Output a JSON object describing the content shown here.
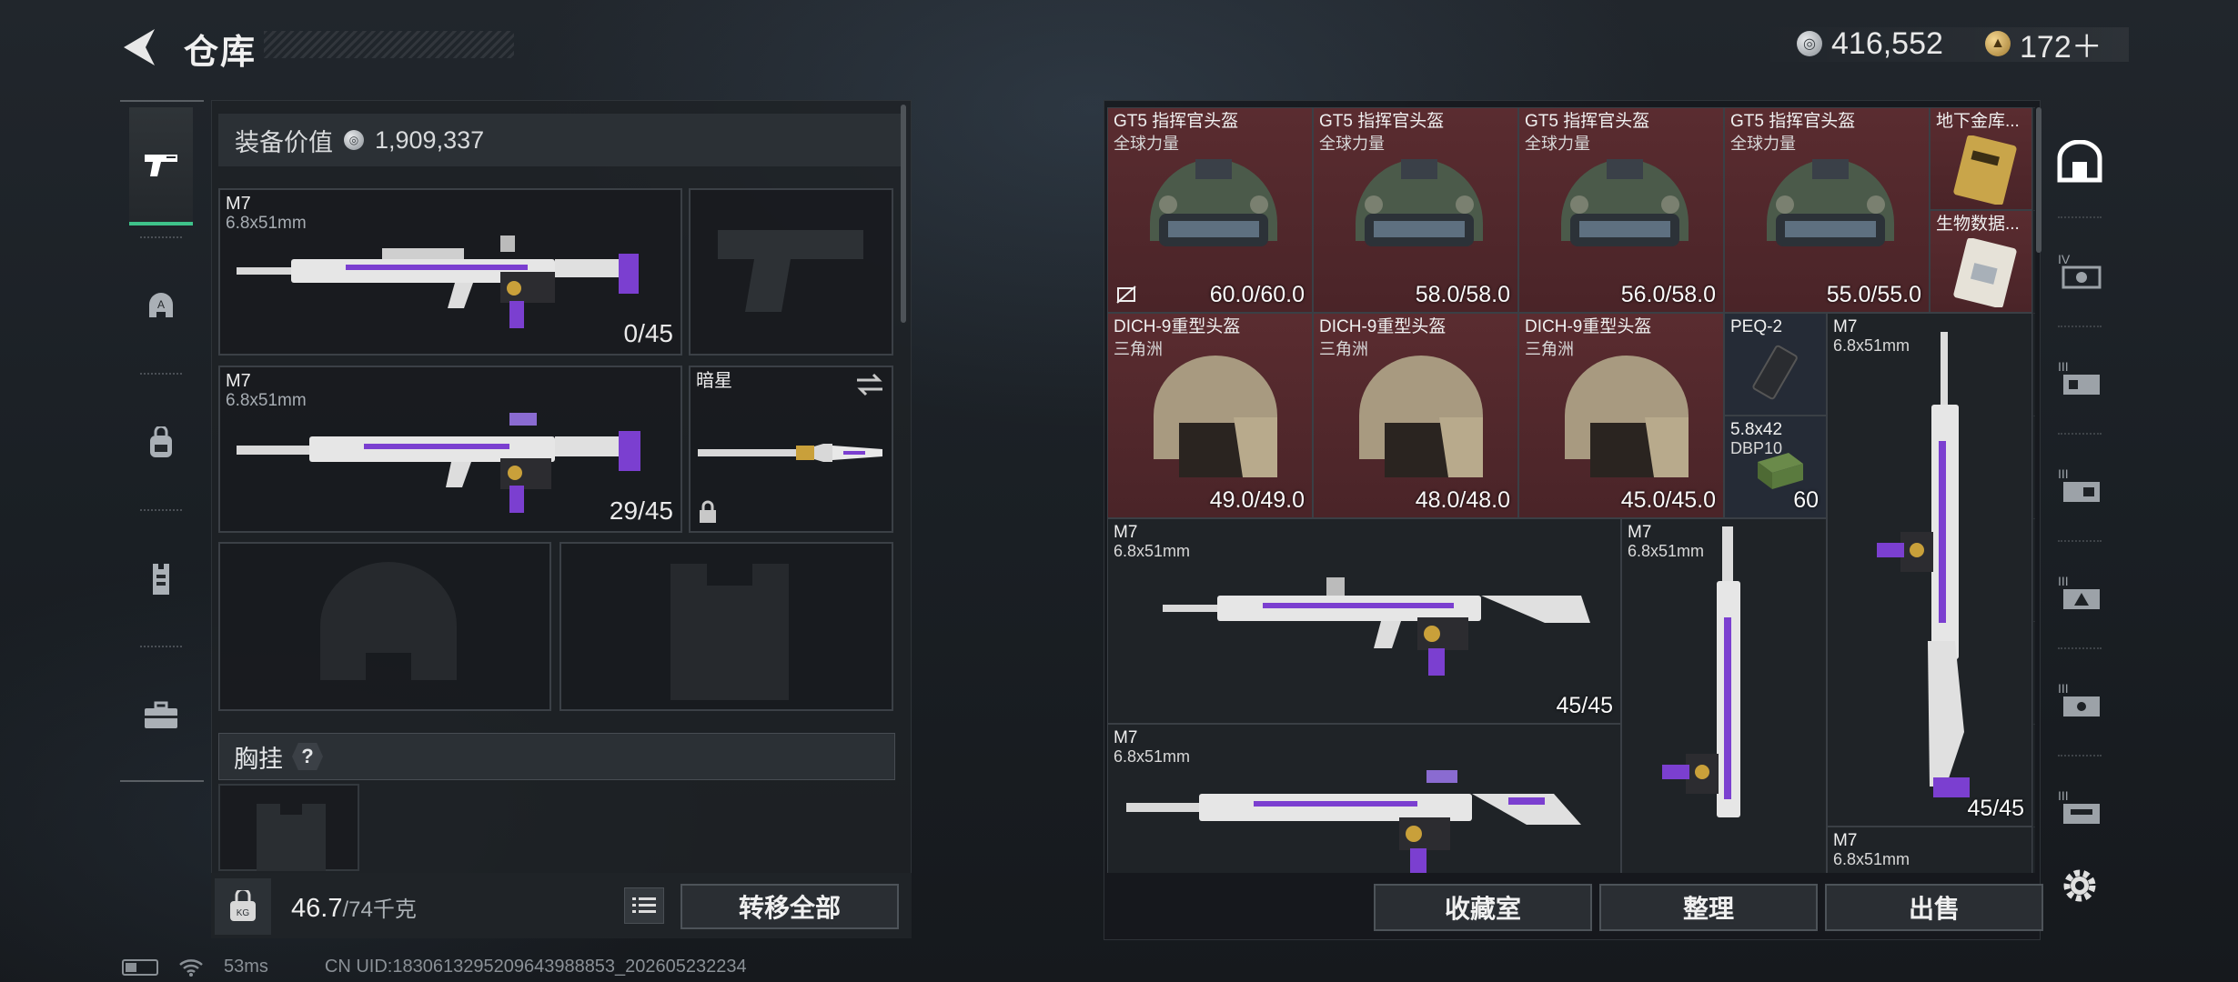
{
  "header": {
    "title": "仓库",
    "currency_silver": "416,552",
    "currency_gold": "172＋"
  },
  "left_panel": {
    "equipment_value_label": "装备价值",
    "equipment_value": "1,909,337",
    "primary_1": {
      "name": "M7",
      "caliber": "6.8x51mm",
      "ammo": "0/45"
    },
    "primary_2": {
      "name": "M7",
      "caliber": "6.8x51mm",
      "ammo": "29/45"
    },
    "melee": {
      "name": "暗星"
    },
    "chest_label": "胸挂",
    "chest_help": "?",
    "weight_current": "46.7",
    "weight_max": "/74千克",
    "transfer_all": "转移全部"
  },
  "stash": {
    "helmets_gt5": [
      {
        "name": "GT5 指挥官头盔",
        "sub": "全球力量",
        "durability": "60.0/60.0"
      },
      {
        "name": "GT5 指挥官头盔",
        "sub": "全球力量",
        "durability": "58.0/58.0"
      },
      {
        "name": "GT5 指挥官头盔",
        "sub": "全球力量",
        "durability": "56.0/58.0"
      },
      {
        "name": "GT5 指挥官头盔",
        "sub": "全球力量",
        "durability": "55.0/55.0"
      }
    ],
    "helmets_dich": [
      {
        "name": "DICH-9重型头盔",
        "sub": "三角洲",
        "durability": "49.0/49.0"
      },
      {
        "name": "DICH-9重型头盔",
        "sub": "三角洲",
        "durability": "48.0/48.0"
      },
      {
        "name": "DICH-9重型头盔",
        "sub": "三角洲",
        "durability": "45.0/45.0"
      }
    ],
    "card_1": "地下金库...",
    "card_2": "生物数据...",
    "peq": "PEQ-2",
    "ammo_item": {
      "name": "5.8x42",
      "sub": "DBP10",
      "count": "60"
    },
    "rifle_vertical_1": {
      "name": "M7",
      "caliber": "6.8x51mm",
      "ammo": "45/45"
    },
    "rifle_h1": {
      "name": "M7",
      "caliber": "6.8x51mm",
      "ammo": "45/45"
    },
    "rifle_h2": {
      "name": "M7",
      "caliber": "6.8x51mm"
    },
    "rifle_vertical_2": {
      "name": "M7",
      "caliber": "6.8x51mm"
    },
    "rifle_vertical_3": {
      "name": "M7",
      "caliber": "6.8x51mm"
    }
  },
  "actions": {
    "collection": "收藏室",
    "sort": "整理",
    "sell": "出售"
  },
  "footer": {
    "ping": "53ms",
    "uid": "CN UID:1830613295209643988853_202605232234"
  },
  "colors": {
    "accent_green": "#3ec28a",
    "rare_red": "#5a2c30",
    "purple": "#7b3fd0"
  }
}
